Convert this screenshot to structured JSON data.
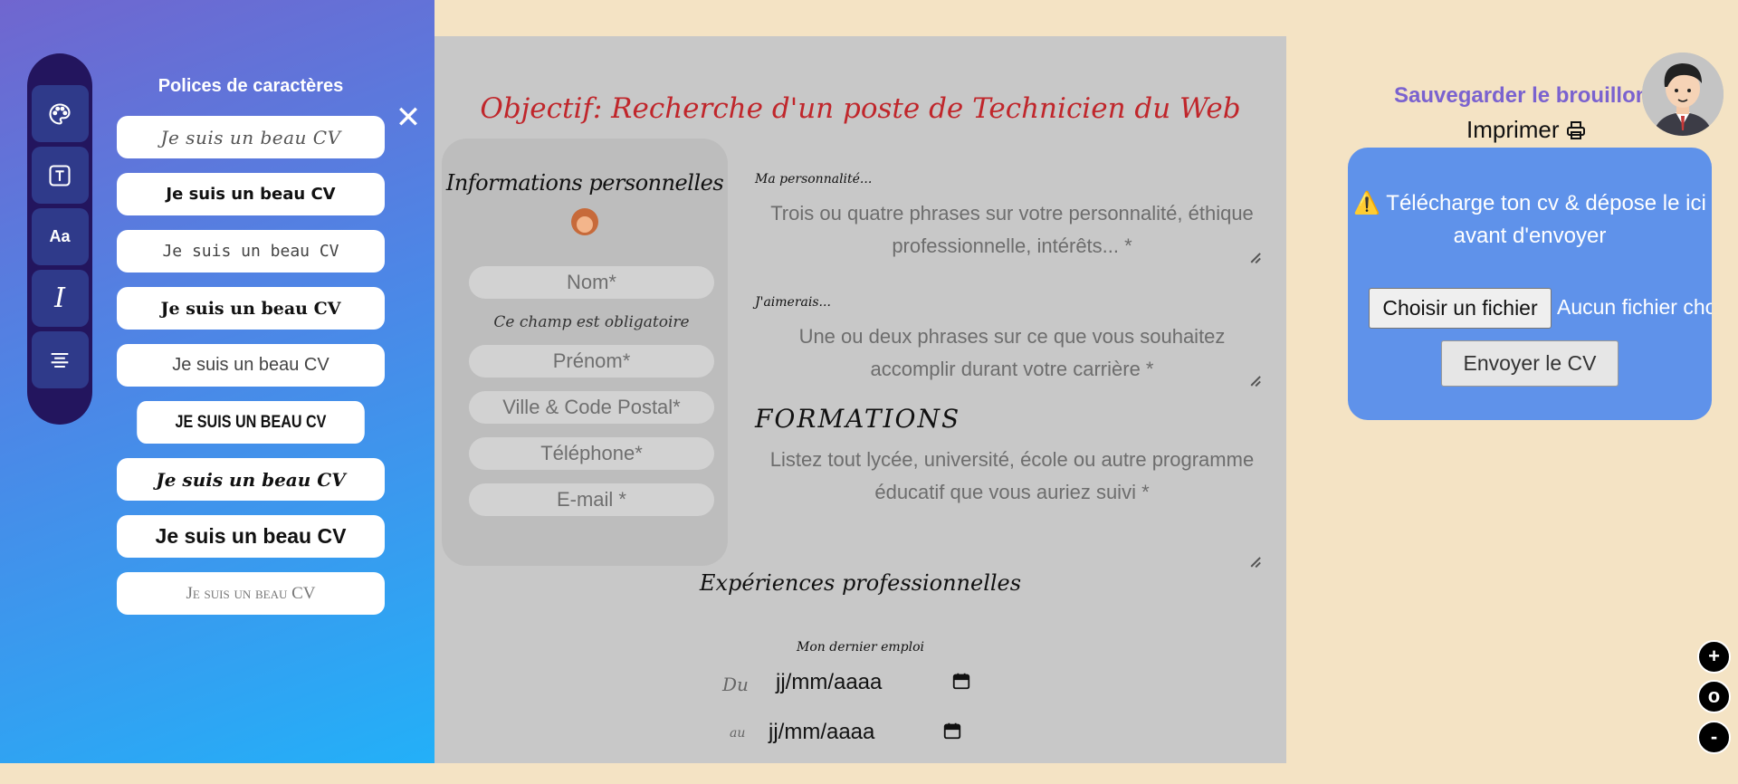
{
  "sidebar": {
    "tools": [
      {
        "icon": "palette-icon"
      },
      {
        "icon": "text-box-icon"
      },
      {
        "icon": "font-size-icon",
        "label": "Aa"
      },
      {
        "icon": "italic-cursor-icon",
        "label": "I"
      },
      {
        "icon": "align-center-icon"
      }
    ],
    "fonts_title": "Polices de caractères",
    "font_options": [
      "Je suis un beau CV",
      "Je suis un beau CV",
      "Je suis un beau CV",
      "Je suis un beau CV",
      "Je suis un beau CV",
      "JE SUIS UN BEAU CV",
      "Je suis un beau CV",
      "Je suis un beau CV",
      "Je suis un beau CV"
    ],
    "close_label": "✕"
  },
  "cv": {
    "objective": "Objectif: Recherche d'un poste de Technicien du Web",
    "personal": {
      "title": "Informations personnelles",
      "name_placeholder": "Nom*",
      "required_note": "Ce champ est obligatoire",
      "firstname_placeholder": "Prénom*",
      "city_placeholder": "Ville & Code Postal*",
      "phone_placeholder": "Téléphone*",
      "email_placeholder": "E-mail *"
    },
    "personality_label": "Ma personnalité...",
    "personality_placeholder": "Trois ou quatre phrases sur votre personnalité, éthique professionnelle, intérêts... *",
    "wish_label": "J'aimerais...",
    "wish_placeholder": "Une ou deux phrases sur ce que vous souhaitez accomplir durant votre carrière *",
    "formations_title": "FORMATIONS",
    "formations_placeholder": "Listez tout lycée, université, école ou autre programme éducatif que vous auriez suivi *",
    "experience_title": "Expériences professionnelles",
    "last_job": "Mon dernier emploi",
    "from_label": "Du",
    "to_label": "au",
    "date_placeholder": "jj/mm/aaaa"
  },
  "right": {
    "save_draft": "Sauvegarder le brouillon",
    "print": "Imprimer",
    "upload_text": "⚠️ Télécharge ton cv & dépose le ici avant d'envoyer",
    "choose_file": "Choisir un fichier",
    "no_file": "Aucun fichier choisi",
    "send": "Envoyer le CV"
  },
  "zoom": {
    "plus": "+",
    "reset": "o",
    "minus": "-"
  },
  "colors": {
    "accent_purple": "#7a62cf",
    "objective_red": "#c0262b",
    "upload_blue": "#5f92ea",
    "background": "#f4e3c4"
  }
}
